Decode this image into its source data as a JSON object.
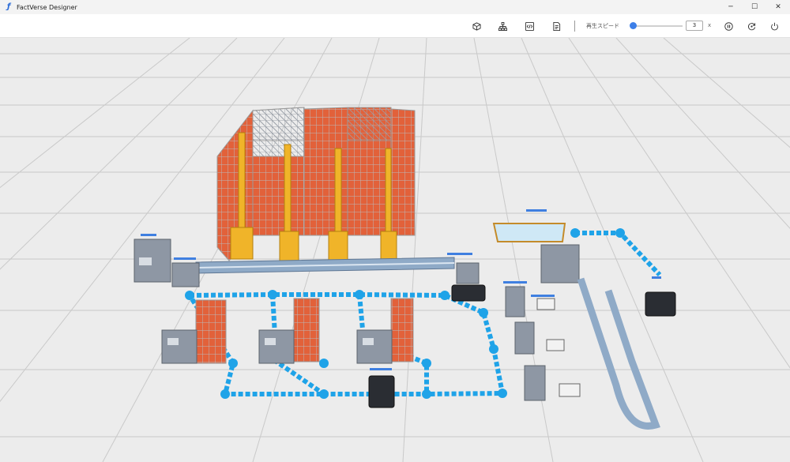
{
  "app": {
    "title": "FactVerse Designer",
    "icon": "factverse-logo-icon"
  },
  "window_controls": {
    "minimize": "─",
    "maximize": "☐",
    "close": "✕"
  },
  "toolbar": {
    "icons": [
      "cube-icon",
      "hierarchy-icon",
      "code-icon",
      "document-icon"
    ],
    "speed_label": "再生スピード",
    "speed_value": "3",
    "speed_unit": "x",
    "speed_slider_fraction": 0.05,
    "playback_icons": [
      "pause-icon",
      "reset-icon",
      "power-icon"
    ]
  },
  "scene": {
    "floor_color": "#ececec",
    "grid_color": "#c9c9c9",
    "path_color": "#1fa3e8",
    "rack_color": "#e2613a",
    "crane_color": "#f0b429",
    "conveyor_color": "#8faac7",
    "machine_color": "#8e97a4"
  }
}
